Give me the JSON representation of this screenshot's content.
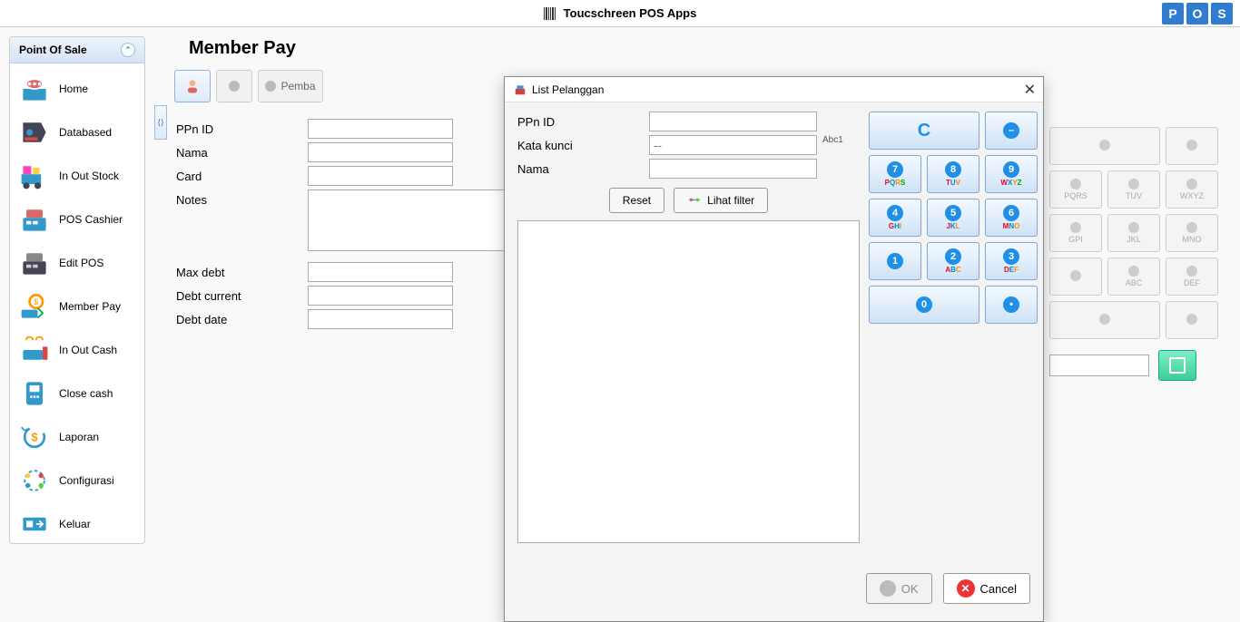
{
  "topbar": {
    "title": "Toucschreen POS Apps",
    "badges": [
      "P",
      "O",
      "S"
    ]
  },
  "sidebar": {
    "header": "Point Of Sale",
    "items": [
      {
        "label": "Home"
      },
      {
        "label": "Databased"
      },
      {
        "label": "In Out Stock"
      },
      {
        "label": "POS Cashier"
      },
      {
        "label": "Edit POS"
      },
      {
        "label": "Member Pay"
      },
      {
        "label": "In Out Cash"
      },
      {
        "label": "Close cash"
      },
      {
        "label": "Laporan"
      },
      {
        "label": "Configurasi"
      },
      {
        "label": "Keluar"
      }
    ]
  },
  "page": {
    "title": "Member Pay",
    "pemb_label": "Pemba"
  },
  "form": {
    "ppnid_label": "PPn ID",
    "nama_label": "Nama",
    "card_label": "Card",
    "notes_label": "Notes",
    "maxdebt_label": "Max debt",
    "debtcurrent_label": "Debt current",
    "debtdate_label": "Debt date"
  },
  "right_keypad": {
    "rows": [
      [
        "PQRS",
        "TUV",
        "WXYZ"
      ],
      [
        "GPI",
        "JKL",
        "MNO"
      ],
      [
        "ABC",
        "DEF"
      ]
    ]
  },
  "modal": {
    "title": "List Pelanggan",
    "ppnid_label": "PPn ID",
    "kata_label": "Kata kunci",
    "kata_hint": "Abc1",
    "kata_placeholder": "--",
    "nama_label": "Nama",
    "reset_label": "Reset",
    "filter_label": "Lihat filter",
    "ok_label": "OK",
    "cancel_label": "Cancel",
    "keypad": {
      "c": "C",
      "keys": [
        {
          "n": "7",
          "l": "PQRS"
        },
        {
          "n": "8",
          "l": "TUV"
        },
        {
          "n": "9",
          "l": "WXYZ"
        },
        {
          "n": "4",
          "l": "GHI"
        },
        {
          "n": "5",
          "l": "JKL"
        },
        {
          "n": "6",
          "l": "MNO"
        },
        {
          "n": "1",
          "l": ""
        },
        {
          "n": "2",
          "l": "ABC"
        },
        {
          "n": "3",
          "l": "DEF"
        }
      ],
      "zero": "0"
    }
  }
}
